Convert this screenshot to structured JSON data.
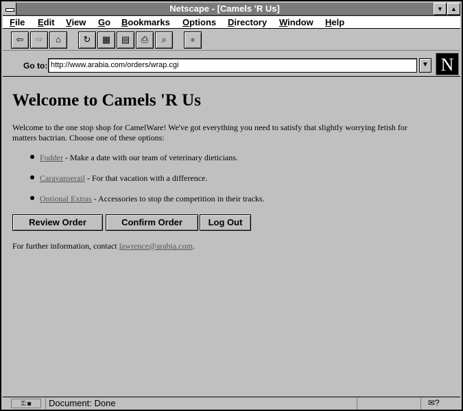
{
  "window": {
    "title": "Netscape - [Camels 'R Us]",
    "min_glyph": "▼",
    "max_glyph": "▲"
  },
  "menu": {
    "file": "File",
    "edit": "Edit",
    "view": "View",
    "go": "Go",
    "bookmarks": "Bookmarks",
    "options": "Options",
    "directory": "Directory",
    "window": "Window",
    "help": "Help"
  },
  "toolbar": {
    "back": "⇦",
    "forward": "⇨",
    "home": "⌂",
    "reload": "↻",
    "images": "▦",
    "open": "▤",
    "print": "⎙",
    "find": "⌕",
    "stop": "●"
  },
  "location": {
    "label": "Go to:",
    "url": "http://www.arabia.com/orders/wrap.cgi",
    "drop_glyph": "▼",
    "logo": "N"
  },
  "page": {
    "heading": "Welcome to Camels 'R Us",
    "intro": "Welcome to the one stop shop for CamelWare! We've got everything you need to satisfy that slightly worrying fetish for matters bactrian. Choose one of these options:",
    "options": [
      {
        "link": "Fodder",
        "text": " - Make a date with our team of veterinary dieticians."
      },
      {
        "link": "Caravanserail",
        "text": " - For that vacation with a difference."
      },
      {
        "link": "Optional Extras",
        "text": " - Accessories to stop the competition in their tracks."
      }
    ],
    "buttons": {
      "review": "Review Order",
      "confirm": "Confirm Order",
      "logout": "Log Out"
    },
    "contact_prefix": "For further information, contact ",
    "contact_email": "lawrence@arabia.com",
    "contact_suffix": "."
  },
  "status": {
    "text": "Document: Done",
    "icons": "⚿ ◙",
    "mail": "✉?"
  }
}
